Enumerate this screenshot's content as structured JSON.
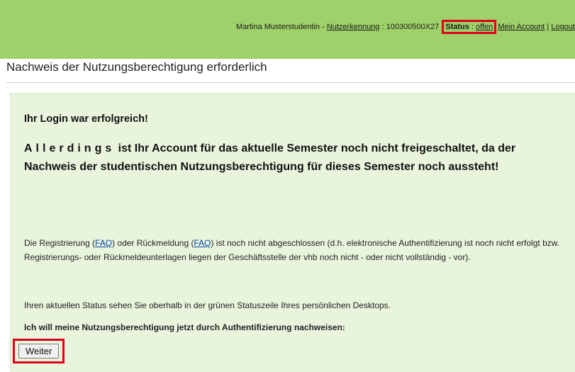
{
  "statusbar": {
    "user_name": "Martina Musterstudentin",
    "dash": " - ",
    "userid_label": "Nutzerkennung",
    "userid_sep": " : ",
    "userid_value": "100300500X27",
    "status_label": "Status",
    "status_sep": " : ",
    "status_value": "offen",
    "account_link": "Mein Account",
    "pipe": " | ",
    "logout_link": "Logout"
  },
  "header": {
    "title": "Nachweis der Nutzungsberechtigung erforderlich"
  },
  "main": {
    "login_ok": "Ihr Login war erfolgreich!",
    "warning_first": "Allerdings",
    "warning_rest": " ist Ihr Account für das aktuelle Semester noch nicht freigeschaltet, da der Nachweis der studentischen Nutzungsberechtigung für dieses Semester noch aussteht!",
    "p1_a": "Die Registrierung (",
    "faq1": "FAQ",
    "p1_b": ") oder Rückmeldung (",
    "faq2": "FAQ",
    "p1_c": ") ist noch nicht abgeschlossen (d.h. elektronische Authentifizierung ist noch nicht erfolgt bzw. Registrierungs- oder Rückmeldeunterlagen liegen der Geschäftsstelle der vhb noch nicht - oder nicht vollständig - vor).",
    "p2": "Ihren aktuellen Status sehen Sie oberhalb in der grünen Statuszeile Ihres persönlichen Desktops.",
    "action_label": "Ich will meine Nutzungsberechtigung jetzt durch Authentifizierung nachweisen:",
    "button_label": "Weiter"
  },
  "colors": {
    "statusbar_bg": "#9fd16a",
    "infobox_bg": "#e8f5dc",
    "highlight_border": "#e0001a",
    "link": "#0645ad"
  }
}
